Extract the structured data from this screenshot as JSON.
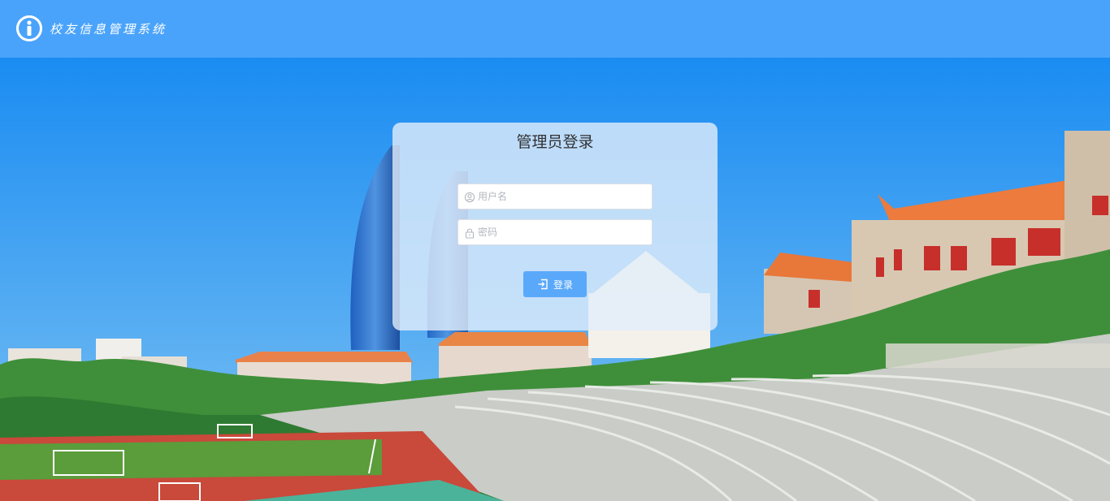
{
  "header": {
    "app_title": "校友信息管理系统",
    "logo_icon": "info-circle-icon",
    "background_color": "#4aa3fb"
  },
  "login": {
    "title": "管理员登录",
    "username_placeholder": "用户名",
    "username_icon": "user-icon",
    "password_placeholder": "密码",
    "password_icon": "lock-icon",
    "submit_label": "登录",
    "submit_icon": "login-icon",
    "button_color": "#5aa8fa"
  },
  "background": {
    "description_icon": "campus-stadium-photo"
  }
}
